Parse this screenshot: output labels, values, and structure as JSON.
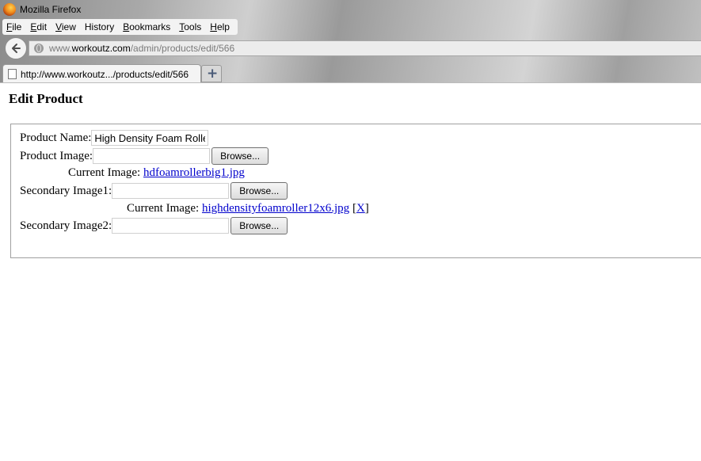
{
  "browser": {
    "title": "Mozilla Firefox",
    "menu": [
      {
        "label": "File",
        "accesskey": "F",
        "rest": "ile"
      },
      {
        "label": "Edit",
        "accesskey": "E",
        "rest": "dit"
      },
      {
        "label": "View",
        "accesskey": "V",
        "rest": "iew"
      },
      {
        "label": "History",
        "accesskey": "",
        "rest": "History"
      },
      {
        "label": "Bookmarks",
        "accesskey": "B",
        "rest": "ookmarks"
      },
      {
        "label": "Tools",
        "accesskey": "T",
        "rest": "ools"
      },
      {
        "label": "Help",
        "accesskey": "H",
        "rest": "elp"
      }
    ],
    "url": {
      "prefix": "www.",
      "domain": "workoutz.com",
      "path": "/admin/products/edit/566"
    },
    "tab_title": "http://www.workoutz.../products/edit/566",
    "new_tab_label": "+"
  },
  "page": {
    "title": "Edit Product",
    "product_name_label": "Product Name:",
    "product_name_value": "High Density Foam Roller",
    "product_image_label": "Product Image:",
    "browse_label": "Browse...",
    "current_image_label": "Current Image:",
    "current_image_file": "hdfoamrollerbig1.jpg",
    "secondary_image1_label": "Secondary Image1:",
    "secondary_image1_file": "highdensityfoamroller12x6.jpg",
    "remove_open": "[",
    "remove_link": "X",
    "remove_close": "]",
    "secondary_image2_label": "Secondary Image2:"
  }
}
